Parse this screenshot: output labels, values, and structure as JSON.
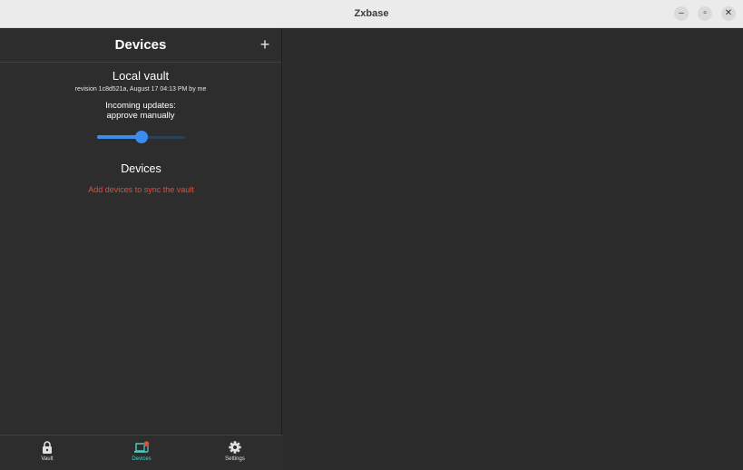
{
  "window": {
    "title": "Zxbase",
    "controls": {
      "minimize": "–",
      "restore": "▫",
      "close": "✕"
    }
  },
  "panel": {
    "title": "Devices",
    "add_label": "+"
  },
  "vault": {
    "title": "Local vault",
    "revision": "revision 1c8d521a, August 17 04:13 PM by me",
    "incoming_line1": "Incoming updates:",
    "incoming_line2": "approve manually",
    "slider_fraction": 0.5
  },
  "devices": {
    "title": "Devices",
    "hint": "Add devices to sync the vault"
  },
  "nav": {
    "items": [
      {
        "label": "Vault",
        "icon": "lock-icon",
        "active": false
      },
      {
        "label": "Devices",
        "icon": "devices-icon",
        "active": true
      },
      {
        "label": "Settings",
        "icon": "gear-icon",
        "active": false
      }
    ]
  },
  "colors": {
    "accent": "#3b8ced",
    "active_nav": "#4fd1c5",
    "alert": "#e74c3c",
    "badge": "#e74c3c"
  }
}
